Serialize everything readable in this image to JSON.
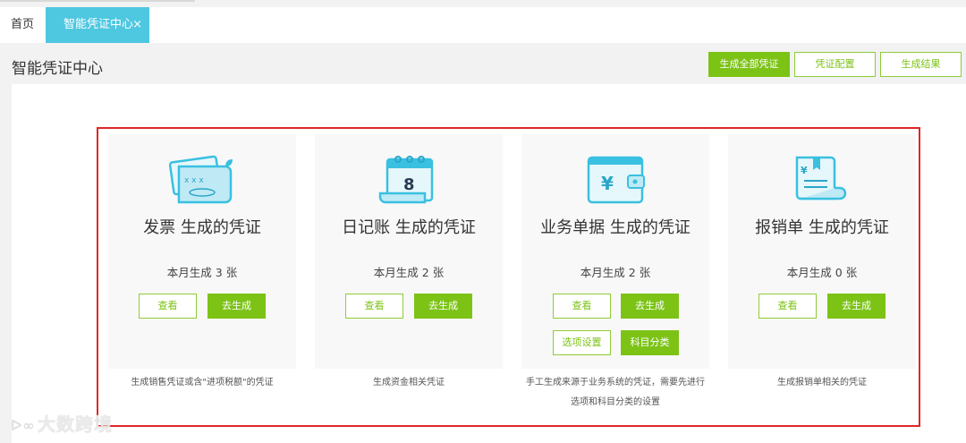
{
  "tabs": {
    "home": "首页",
    "active": "智能凭证中心",
    "close": "×"
  },
  "header": {
    "title": "智能凭证中心",
    "btn_generate_all": "生成全部凭证",
    "btn_config": "凭证配置",
    "btn_result": "生成结果"
  },
  "cards": [
    {
      "title": "发票 生成的凭证",
      "count": "本月生成 3 张",
      "view": "查看",
      "generate": "去生成",
      "desc": "生成销售凭证或含\"进项税额\"的凭证",
      "icon": "invoice-icon"
    },
    {
      "title": "日记账 生成的凭证",
      "count": "本月生成 2 张",
      "view": "查看",
      "generate": "去生成",
      "desc": "生成资金相关凭证",
      "icon": "journal-icon"
    },
    {
      "title": "业务单据 生成的凭证",
      "count": "本月生成  2 张",
      "view": "查看",
      "generate": "去生成",
      "options": "选项设置",
      "subject": "科目分类",
      "desc_line1": "手工生成来源于业务系统的凭证，需要先进行",
      "desc_line2": "选项和科目分类的设置",
      "icon": "wallet-icon"
    },
    {
      "title": "报销单 生成的凭证",
      "count": "本月生成  0 张",
      "view": "查看",
      "generate": "去生成",
      "desc": "生成报销单相关的凭证",
      "icon": "receipt-icon"
    }
  ],
  "watermark": "大数跨境",
  "colors": {
    "accent_green": "#7cc316",
    "tab_cyan": "#4ec7e0",
    "icon_cyan": "#3ac0e0",
    "highlight_red": "#e02727"
  }
}
